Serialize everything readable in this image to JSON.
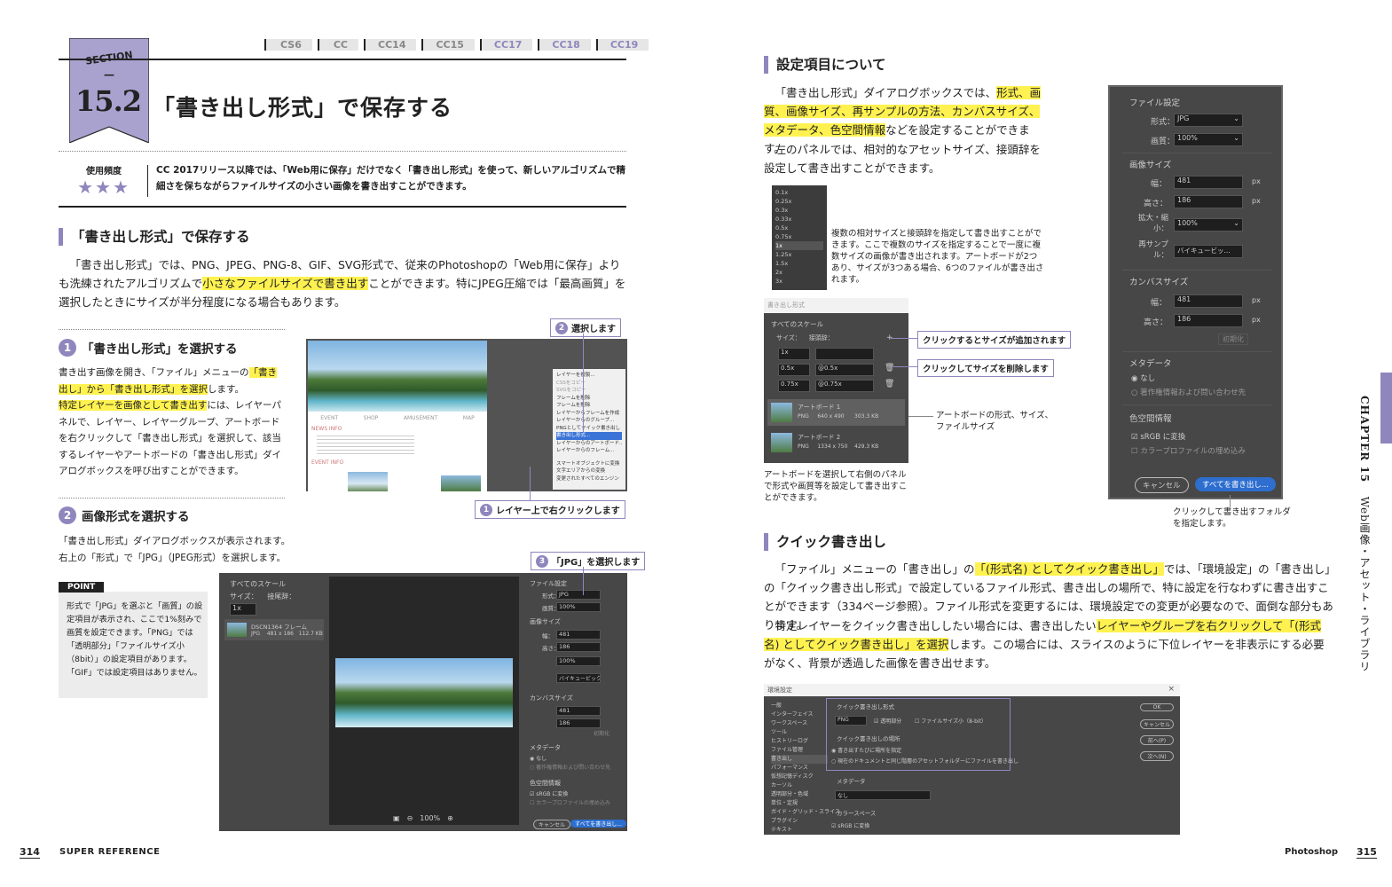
{
  "left": {
    "section_word": "SECTION",
    "section_dash": "—",
    "section_num": "15.2",
    "versions": [
      "CS6",
      "CC",
      "CC14",
      "CC15",
      "CC17",
      "CC18",
      "CC19"
    ],
    "title": "「書き出し形式」で保存する",
    "freq_label": "使用頻度",
    "stars": "★★★",
    "intro": "CC 2017リリース以降では、「Web用に保存」だけでなく「書き出し形式」を使って、新しいアルゴリズムで精細さを保ちながらファイルサイズの小さい画像を書き出すことができます。",
    "h2": "「書き出し形式」で保存する",
    "body1_a": "「書き出し形式」では、PNG、JPEG、PNG-8、GIF、SVG形式で、従来のPhotoshopの「Web用に保存」よりも洗練されたアルゴリズムで",
    "body1_hl": "小さなファイルサイズで書き出す",
    "body1_b": "ことができます。特にJPEG圧縮では「最高画質」を選択したときにサイズが半分程度になる場合もあります。",
    "step1_num": "1",
    "step1_title": "「書き出し形式」を選択する",
    "step1_a": "書き出す画像を開き、「ファイル」メニューの",
    "step1_hl1": "「書き出し」から「書き出し形式」を選択",
    "step1_b": "します。",
    "step1_hl2": "特定レイヤーを画像として書き出す",
    "step1_c": "には、レイヤーパネルで、レイヤー、レイヤーグループ、アートボードを右クリックして「書き出し形式」を選択して、該当するレイヤーやアートボードの「書き出し形式」ダイアログボックスを呼び出すことができます。",
    "step2_num": "2",
    "step2_title": "画像形式を選択する",
    "step2_text": "「書き出し形式」ダイアログボックスが表示されます。右上の「形式」で「JPG」（JPEG形式）を選択します。",
    "point_label": "POINT",
    "point_text": "形式で「JPG」を選ぶと「画質」の設定項目が表示され、ここで1%刻みで画質を設定できます。「PNG」では「透明部分」「ファイルサイズ小（8bit）」の設定項目があります。「GIF」では設定項目はありません。",
    "callout_1": "レイヤー上で右クリックします",
    "callout_2": "選択します",
    "callout_3": "「JPG」を選択します",
    "c1": "1",
    "c2": "2",
    "c3": "3",
    "page_num": "314",
    "footer": "SUPER REFERENCE",
    "ss1": {
      "nav": [
        "EVENT",
        "SHOP",
        "AMUSEMENT",
        "MAP"
      ],
      "news": "NEWS INFO",
      "event": "EVENT INFO",
      "menu": [
        "レイヤーを複製...",
        "CSSをコピー",
        "SVGをコピー",
        "フレームを削除",
        "フレームを削除",
        "レイヤーからフレームを作成",
        "レイヤーからのグループ...",
        "PNGとしてクイック書き出し",
        "書き出し形式...",
        "レイヤーからのアートボード...",
        "レイヤーからのフレーム...",
        "スマートオブジェクトに変換",
        "文字エリアからの変換",
        "変更されたすべてのエンジン"
      ]
    },
    "ss2": {
      "scale_label": "すべてのスケール",
      "size_label": "サイズ：",
      "suffix_label": "接尾辞：",
      "scale_val": "1x",
      "item_name": "DSCN1364 フレーム",
      "item_fmt": "JPG",
      "item_dim": "481 x 186",
      "item_size": "112.7 KB",
      "file_settings": "ファイル設定",
      "format_label": "形式：",
      "format_val": "JPG",
      "quality_label": "画質：",
      "quality_val": "100%",
      "image_size": "画像サイズ",
      "w_label": "幅：",
      "w_val": "481",
      "h_label": "高さ：",
      "h_val": "186",
      "scale2_label": "拡大・縮小：",
      "scale2_val": "100%",
      "resample_label": "再サンプル：",
      "resample_val": "バイキュービック",
      "canvas_size": "カンバスサイズ",
      "cw_val": "481",
      "ch_val": "186",
      "reset": "初期化",
      "meta": "メタデータ",
      "meta_none": "なし",
      "meta_copy": "著作権情報および問い合わせ先",
      "color": "色空間情報",
      "srgb": "sRGB に変換",
      "embed": "カラープロファイルの埋め込み",
      "zoom": "100%",
      "cancel": "キャンセル",
      "export_all": "すべてを書き出し..."
    }
  },
  "right": {
    "h2_settings": "設定項目について",
    "set_a": "「書き出し形式」ダイアログボックスでは、",
    "set_hl": "形式、画質、画像サイズ、再サンプルの方法、カンバスサイズ、メタデータ、色空間情報",
    "set_b": "などを設定することができます。",
    "set_c": "左のパネルでは、相対的なアセットサイズ、接頭辞を設定して書き出すことができます。",
    "scale_list": [
      "0.1x",
      "0.25x",
      "0.3x",
      "0.33x",
      "0.5x",
      "0.75x",
      "1x",
      "1.25x",
      "1.5x",
      "2x",
      "3x"
    ],
    "scale_note": "複数の相対サイズと接頭辞を指定して書き出すことができます。ここで複数のサイズを指定することで一度に複数サイズの画像が書き出されます。アートボードが2つあり、サイズが3つある場合、6つのファイルが書き出されます。",
    "left_panel": {
      "header": "書き出し形式",
      "all_scales": "すべてのスケール",
      "size": "サイズ：",
      "prefix": "接頭辞：",
      "rows": [
        {
          "s": "1x",
          "p": ""
        },
        {
          "s": "0.5x",
          "p": "@0.5x"
        },
        {
          "s": "0.75x",
          "p": "@0.75x"
        }
      ],
      "ab1_name": "アートボード 1",
      "ab1_fmt": "PNG",
      "ab1_dim": "640 x 490",
      "ab1_size": "303.3 KB",
      "ab2_name": "アートボード 2",
      "ab2_fmt": "PNG",
      "ab2_dim": "1334 x 750",
      "ab2_size": "429.3 KB"
    },
    "callout_add": "クリックするとサイズが追加されます",
    "callout_del": "クリックしてサイズを削除します",
    "note_ab": "アートボードの形式、サイズ、ファイルサイズ",
    "note_sel": "アートボードを選択して右側のパネルで形式や画質等を設定して書き出すことができます。",
    "panel": {
      "file_settings": "ファイル設定",
      "format_label": "形式：",
      "format_val": "JPG",
      "quality_label": "画質：",
      "quality_val": "100%",
      "image_size": "画像サイズ",
      "w_label": "幅：",
      "w_val": "481",
      "h_label": "高さ：",
      "h_val": "186",
      "scale_label": "拡大・縮小：",
      "scale_val": "100%",
      "resample_label": "再サンプル：",
      "resample_val": "バイキュービッ...",
      "canvas_size": "カンバスサイズ",
      "cw_label": "幅：",
      "cw_val": "481",
      "ch_label": "高さ：",
      "ch_val": "186",
      "px": "px",
      "reset": "初期化",
      "meta": "メタデータ",
      "meta_none": "なし",
      "meta_copy": "著作権情報および問い合わせ先",
      "color": "色空間情報",
      "srgb": "sRGB に変換",
      "embed": "カラープロファイルの埋め込み",
      "cancel": "キャンセル",
      "export_all": "すべてを書き出し..."
    },
    "note_folder": "クリックして書き出すフォルダを指定します。",
    "h2_quick": "クイック書き出し",
    "quick_a": "「ファイル」メニューの「書き出し」の",
    "quick_hl1": "「(形式名) としてクイック書き出し」",
    "quick_b": "では、「環境設定」の「書き出し」の「クイック書き出し形式」で設定しているファイル形式、書き出しの場所で、特に設定を行なわずに書き出すことができます（334ページ参照）。ファイル形式を変更するには、環境設定での変更が必要なので、面倒な部分もあります。",
    "quick_c": "特定レイヤーをクイック書き出ししたい場合には、書き出したい",
    "quick_hl2": "レイヤーやグループを右クリックして「(形式名) としてクイック書き出し」を選択",
    "quick_d": "します。この場合には、スライスのように下位レイヤーを非表示にする必要がなく、背景が透過した画像を書き出せます。",
    "prefs": {
      "title": "環境設定",
      "nav": [
        "一般",
        "インターフェイス",
        "ワークスペース",
        "ツール",
        "ヒストリーログ",
        "ファイル管理",
        "書き出し",
        "パフォーマンス",
        "仮想記憶ディスク",
        "カーソル",
        "透明部分・色域",
        "単位・定規",
        "ガイド・グリッド・スライス",
        "プラグイン",
        "テキスト"
      ],
      "quick_fmt": "クイック書き出し形式",
      "fmt_val": "PNG",
      "transparent": "透明部分",
      "small_file": "ファイルサイズ小（8-bit）",
      "location": "クイック書き出しの場所",
      "loc1": "書き出すたびに場所を指定",
      "loc2": "現在のドキュメントと同じ階層のアセットフォルダーにファイルを書き出し",
      "meta": "メタデータ",
      "meta_val": "なし",
      "color": "カラースペース",
      "srgb": "sRGB に変換",
      "btns": [
        "OK",
        "キャンセル",
        "前へ(P)",
        "次へ(N)"
      ]
    },
    "chapter": "CHAPTER 15",
    "chapter_title": "Web画像・アセット・ライブラリ",
    "page_num": "315",
    "footer": "Photoshop"
  }
}
